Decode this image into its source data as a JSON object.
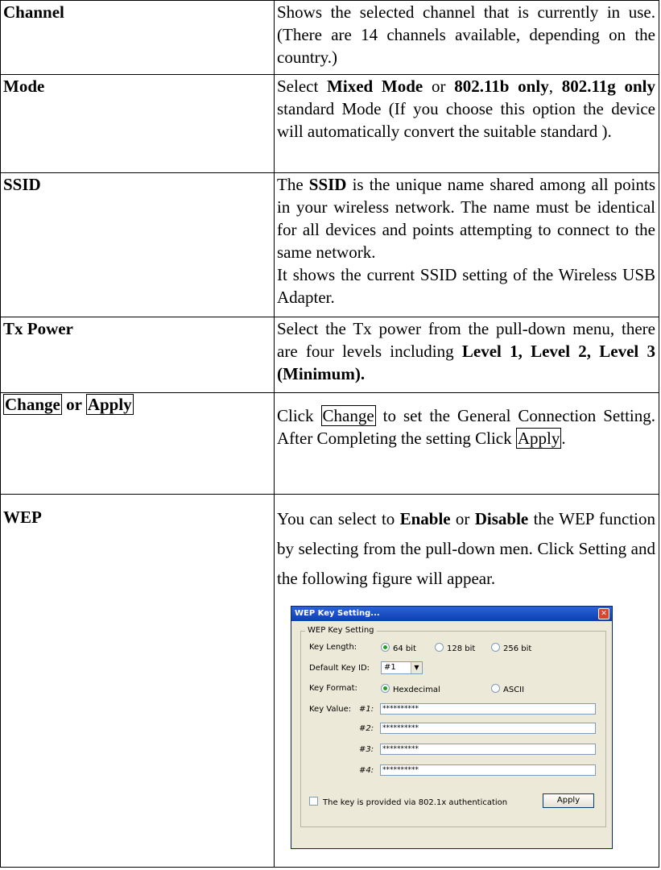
{
  "rows": {
    "channel": {
      "term": "Channel",
      "desc": "Shows the selected channel that is currently in use. (There are 14 channels available, depending on the country.)"
    },
    "mode": {
      "term": "Mode",
      "p1": "Select ",
      "b1": "Mixed Mode",
      "p2": " or ",
      "b2": "802.11b only",
      "p3": ", ",
      "b3": "802.11g only",
      "p4": " standard Mode (If you choose this option the device will automatically convert the suitable standard )."
    },
    "ssid": {
      "term": "SSID",
      "p1": "The ",
      "b1": "SSID",
      "p2": " is the unique name shared among all points in your wireless network. The name must be identical for all devices and points attempting to connect to the same network.",
      "line2": "It shows the current SSID setting of the Wireless USB Adapter."
    },
    "txpower": {
      "term": "Tx Power",
      "p1": "Select the Tx power from the pull-down menu, there are four levels including ",
      "b1": "Level 1, Level 2, Level 3 (Minimum)."
    },
    "change": {
      "term_a": "Change",
      "term_or": " or ",
      "term_b": "Apply",
      "p1": "Click ",
      "btn1": "Change",
      "p2": " to set the General Connection Setting. After Completing the setting Click ",
      "btn2": "Apply",
      "p3": "."
    },
    "wep": {
      "term": "WEP",
      "p1": "You can select to ",
      "b1": "Enable",
      "p2": " or ",
      "b2": "Disable",
      "p3": " the WEP function by selecting from the pull-down men. Click Setting and the following figure will appear."
    }
  },
  "dialog": {
    "title": "WEP Key Setting...",
    "group": "WEP Key Setting",
    "key_length_label": "Key Length:",
    "key_lengths": [
      "64 bit",
      "128 bit",
      "256 bit"
    ],
    "key_length_selected": "64 bit",
    "default_key_label": "Default Key ID:",
    "default_key_value": "#1",
    "key_format_label": "Key Format:",
    "formats": [
      "Hexdecimal",
      "ASCII"
    ],
    "format_selected": "Hexdecimal",
    "key_value_label": "Key Value:",
    "keys": [
      {
        "id": "#1:",
        "value": "**********"
      },
      {
        "id": "#2:",
        "value": "**********"
      },
      {
        "id": "#3:",
        "value": "**********"
      },
      {
        "id": "#4:",
        "value": "**********"
      }
    ],
    "checkbox_label": "The key is provided via 802.1x authentication",
    "apply": "Apply"
  }
}
